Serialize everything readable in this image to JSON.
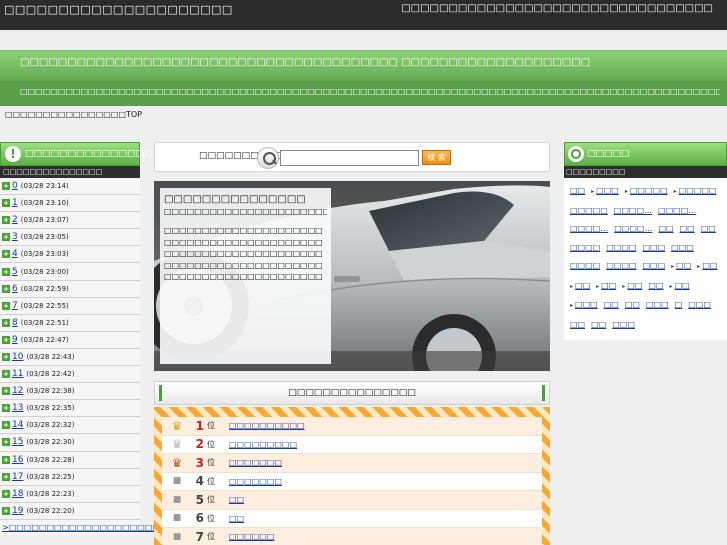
{
  "header": {
    "site_title": "□□□□□□□□□□□□□□□□□□□□□",
    "tagline": "□□□□□□□□□□□□□□□□□□□□□□□□□□□□□□□□□"
  },
  "banner": {
    "title": "□□□□□□□□□□□□□□□□□□□□□□□□□□□□□□□□□□□□□□□□ □□□□□□□□□□□□□□□□□□□□",
    "subtitle": "□□□□□□□□□□□□□□□□□□□□□□□□□□□□□□□□□□□□□□□□□□□□□□□□□□□□□□□□□□□□□□□□□□□□□□□□□□□□□□□□□□□□□□□□□□□□□□□□□□□□□□□□□□□□□□□□"
  },
  "breadcrumb": "□□□□□□□□□□□□□□□□TOP",
  "left": {
    "title": "□□□□□□□□□□□□□□□",
    "subtitle": "□□□□□□□□□□□□□□□",
    "items": [
      {
        "label": "0",
        "time": "(03/28 23:14)"
      },
      {
        "label": "1",
        "time": "(03/28 23:10)"
      },
      {
        "label": "2",
        "time": "(03/28 23:07)"
      },
      {
        "label": "3",
        "time": "(03/28 23:05)"
      },
      {
        "label": "4",
        "time": "(03/28 23:03)"
      },
      {
        "label": "5",
        "time": "(03/28 23:00)"
      },
      {
        "label": "6",
        "time": "(03/28 22:59)"
      },
      {
        "label": "7",
        "time": "(03/28 22:55)"
      },
      {
        "label": "8",
        "time": "(03/28 22:51)"
      },
      {
        "label": "9",
        "time": "(03/28 22:47)"
      },
      {
        "label": "10",
        "time": "(03/28 22:43)"
      },
      {
        "label": "11",
        "time": "(03/28 22:42)"
      },
      {
        "label": "12",
        "time": "(03/28 22:38)"
      },
      {
        "label": "13",
        "time": "(03/28 22:35)"
      },
      {
        "label": "14",
        "time": "(03/28 22:32)"
      },
      {
        "label": "15",
        "time": "(03/28 22:30)"
      },
      {
        "label": "16",
        "time": "(03/28 22:28)"
      },
      {
        "label": "17",
        "time": "(03/28 22:25)"
      },
      {
        "label": "18",
        "time": "(03/28 22:23)"
      },
      {
        "label": "19",
        "time": "(03/28 22:20)"
      }
    ],
    "more_link": ">□□□□□□□□□□□□□□□□□□□□□□□□□□□□□□□□"
  },
  "search": {
    "label": "□□□□□□□□□□",
    "value": "",
    "button": "検 索"
  },
  "hero": {
    "title": "□□□□□□□□□□□□□□□",
    "subtitle": "□□□□□□□□□□□□□□□□□□□□□□□□□□□",
    "body": "□□□□□□□□□□□□□□□□□□□□□□□□□□□□□□□□□□□□□□□□□□□□□□□□□□□□□□□□□□□□□□□□□□□□□□□□□□□□□□□□□□□□□□□□□□□□□□□□□□□□□□□□□"
  },
  "ranking": {
    "title": "□□□□□□□□□□□□□□□",
    "suffix": "位",
    "rows": [
      {
        "rank": "1",
        "icon": "crown-gold-icon",
        "label": "□□□□□□□□□□"
      },
      {
        "rank": "2",
        "icon": "crown-silver-icon",
        "label": "□□□□□□□□□"
      },
      {
        "rank": "3",
        "icon": "crown-bronze-icon",
        "label": "□□□□□□□"
      },
      {
        "rank": "4",
        "icon": "dot-icon",
        "label": "□□□□□□□"
      },
      {
        "rank": "5",
        "icon": "dot-icon",
        "label": "□□"
      },
      {
        "rank": "6",
        "icon": "dot-icon",
        "label": "□□"
      },
      {
        "rank": "7",
        "icon": "dot-icon",
        "label": "□□□□□□"
      }
    ]
  },
  "right": {
    "title": "□□□□□",
    "subtitle": "□□□□□□□□□",
    "tags": [
      {
        "label": "□□",
        "arrow": false
      },
      {
        "label": "□□□",
        "arrow": true
      },
      {
        "label": "□□□□□",
        "arrow": true
      },
      {
        "label": "□□□□□",
        "arrow": true
      },
      {
        "label": "□□□□□",
        "arrow": false
      },
      {
        "label": "□□□□…",
        "arrow": false
      },
      {
        "label": "□□□□…",
        "arrow": false
      },
      {
        "label": "□□□□…",
        "arrow": false
      },
      {
        "label": "□□□□…",
        "arrow": false
      },
      {
        "label": "□□",
        "arrow": false
      },
      {
        "label": "□□",
        "arrow": false
      },
      {
        "label": "□□",
        "arrow": false
      },
      {
        "label": "□□□□",
        "arrow": false
      },
      {
        "label": "□□□□",
        "arrow": false
      },
      {
        "label": "□□□",
        "arrow": false
      },
      {
        "label": "□□□",
        "arrow": false
      },
      {
        "label": "□□□□",
        "arrow": false
      },
      {
        "label": "□□□□",
        "arrow": false
      },
      {
        "label": "□□□",
        "arrow": false
      },
      {
        "label": "□□",
        "arrow": true
      },
      {
        "label": "□□",
        "arrow": true
      },
      {
        "label": "□□",
        "arrow": true
      },
      {
        "label": "□□",
        "arrow": true
      },
      {
        "label": "□□",
        "arrow": true
      },
      {
        "label": "□□",
        "arrow": false
      },
      {
        "label": "□□",
        "arrow": true
      },
      {
        "label": "□□□",
        "arrow": true
      },
      {
        "label": "□□",
        "arrow": false
      },
      {
        "label": "□□",
        "arrow": false
      },
      {
        "label": "□□□",
        "arrow": false
      },
      {
        "label": "□",
        "arrow": false
      },
      {
        "label": "□□□",
        "arrow": false
      },
      {
        "label": "□□",
        "arrow": false
      },
      {
        "label": "□□",
        "arrow": false
      },
      {
        "label": "□□□",
        "arrow": false
      }
    ]
  },
  "colors": {
    "green_accent": "#5cae45",
    "dark_bar": "#2c2c2c",
    "orange_stripe": "#f7a733",
    "rank_red": "#c0241a"
  }
}
